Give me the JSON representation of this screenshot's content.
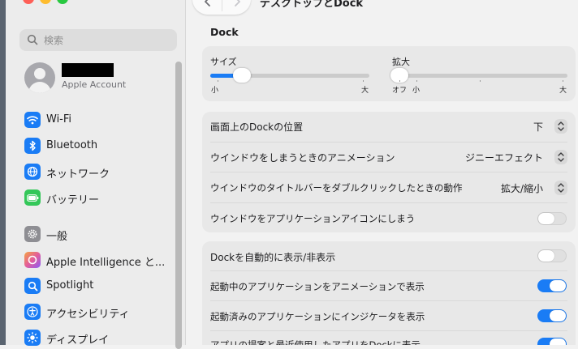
{
  "window": {
    "title": "デスクトップとDock",
    "back_icon": "chevron-left-icon",
    "forward_icon": "chevron-right-icon"
  },
  "sidebar": {
    "search_placeholder": "検索",
    "account": {
      "subtitle": "Apple Account"
    },
    "items": [
      {
        "label": "Wi-Fi",
        "icon": "wifi-icon",
        "color": "#1a7cf5"
      },
      {
        "label": "Bluetooth",
        "icon": "bluetooth-icon",
        "color": "#1a7cf5"
      },
      {
        "label": "ネットワーク",
        "icon": "globe-icon",
        "color": "#1a7cf5"
      },
      {
        "label": "バッテリー",
        "icon": "battery-icon",
        "color": "#34c759"
      },
      {
        "label": "一般",
        "icon": "gear-icon",
        "color": "#8e8e93"
      },
      {
        "label": "Apple Intelligence と...",
        "icon": "apple-intelligence-icon",
        "color": "#e35d9a"
      },
      {
        "label": "Spotlight",
        "icon": "magnifier-icon",
        "color": "#1a7cf5"
      },
      {
        "label": "アクセシビリティ",
        "icon": "accessibility-icon",
        "color": "#1a7cf5"
      },
      {
        "label": "ディスプレイ",
        "icon": "sun-icon",
        "color": "#1a7cf5"
      }
    ]
  },
  "dock": {
    "section_title": "Dock",
    "size_slider": {
      "label": "サイズ",
      "min_label": "小",
      "max_label": "大",
      "value_fraction": 0.2
    },
    "magnification_slider": {
      "label": "拡大",
      "off_label": "オフ",
      "min_label": "小",
      "max_label": "大",
      "value_fraction": 0.0
    },
    "settings": [
      {
        "label": "画面上のDockの位置",
        "value": "下",
        "control": "popup"
      },
      {
        "label": "ウインドウをしまうときのアニメーション",
        "value": "ジニーエフェクト",
        "control": "popup"
      },
      {
        "label": "ウインドウのタイトルバーをダブルクリックしたときの動作",
        "value": "拡大/縮小",
        "control": "popup"
      },
      {
        "label": "ウインドウをアプリケーションアイコンにしまう",
        "state": "off",
        "control": "toggle"
      }
    ],
    "toggles": [
      {
        "label": "Dockを自動的に表示/非表示",
        "state": "off"
      },
      {
        "label": "起動中のアプリケーションをアニメーションで表示",
        "state": "on"
      },
      {
        "label": "起動済みのアプリケーションにインジケータを表示",
        "state": "on"
      },
      {
        "label": "アプリの提案と最近使用したアプリをDockに表示",
        "state": "on"
      }
    ],
    "accent_color": "#1a7cf5"
  }
}
